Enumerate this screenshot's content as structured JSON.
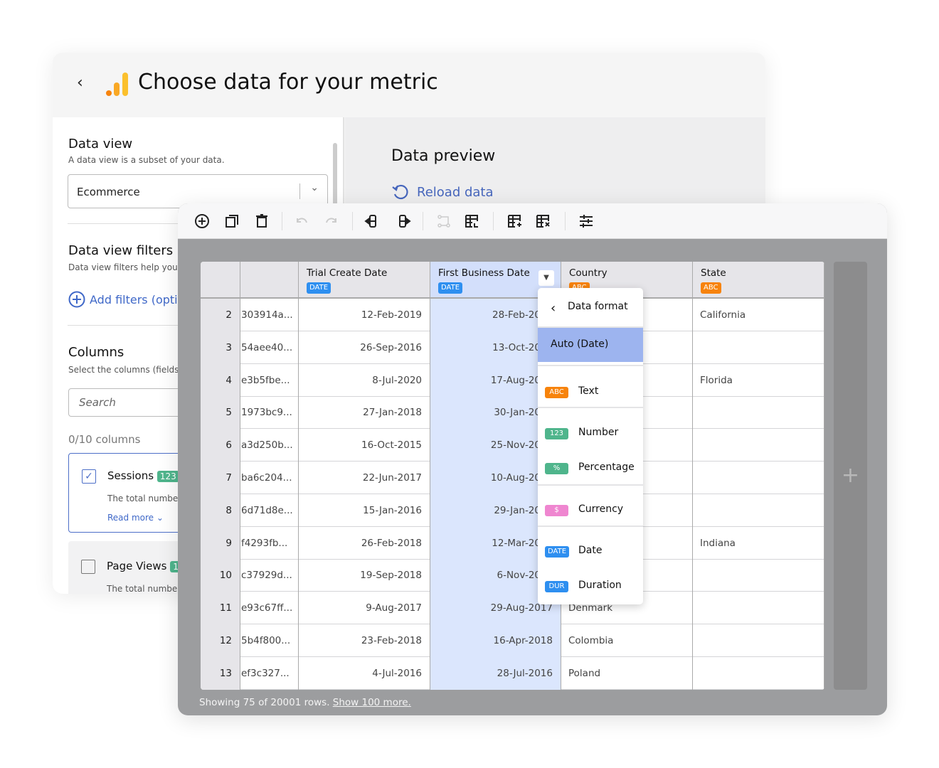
{
  "header": {
    "title": "Choose data for your metric",
    "back_icon": "chevron-left-icon",
    "logo_colors": [
      "#f7830c",
      "#f9a825",
      "#fbc02d"
    ]
  },
  "left": {
    "data_view": {
      "title": "Data view",
      "subtitle": "A data view is a subset of your data.",
      "selected": "Ecommerce"
    },
    "filters": {
      "title": "Data view filters",
      "subtitle": "Data view filters help you r",
      "add_label": "Add filters (optic"
    },
    "columns": {
      "title": "Columns",
      "subtitle": "Select the columns (fields)",
      "search_placeholder": "Search",
      "count": "0/10 columns",
      "items": [
        {
          "name": "Sessions",
          "badge": "123",
          "desc": "The total number",
          "read_more": "Read more",
          "checked": true
        },
        {
          "name": "Page Views",
          "badge": "1",
          "desc": "The total number",
          "checked": false
        }
      ]
    }
  },
  "preview": {
    "title": "Data preview",
    "reload": "Reload data"
  },
  "toolbar": {
    "icons": [
      "add-circle-icon",
      "duplicate-icon",
      "delete-icon",
      "undo-icon",
      "redo-icon",
      "insert-column-left-icon",
      "insert-column-right-icon",
      "link-icon",
      "table-move-icon",
      "table-add-row-icon",
      "table-delete-row-icon",
      "settings-sliders-icon"
    ]
  },
  "table": {
    "columns": [
      {
        "label": ""
      },
      {
        "label": ""
      },
      {
        "label": "Trial Create Date",
        "badge": "DATE"
      },
      {
        "label": "First Business Date",
        "badge": "DATE"
      },
      {
        "label": "Country",
        "badge": "ABC"
      },
      {
        "label": "State",
        "badge": "ABC"
      }
    ],
    "rows": [
      [
        "2",
        "303914a...",
        "12-Feb-2019",
        "28-Feb-20",
        "",
        "California"
      ],
      [
        "3",
        "54aee40...",
        "26-Sep-2016",
        "13-Oct-20",
        "",
        ""
      ],
      [
        "4",
        "e3b5fbe...",
        "8-Jul-2020",
        "17-Aug-20",
        "",
        "Florida"
      ],
      [
        "5",
        "1973bc9...",
        "27-Jan-2018",
        "30-Jan-20",
        "",
        ""
      ],
      [
        "6",
        "a3d250b...",
        "16-Oct-2015",
        "25-Nov-20",
        "",
        ""
      ],
      [
        "7",
        "ba6c204...",
        "22-Jun-2017",
        "10-Aug-20",
        "",
        ""
      ],
      [
        "8",
        "6d71d8e...",
        "15-Jan-2016",
        "29-Jan-20",
        "",
        ""
      ],
      [
        "9",
        "f4293fb...",
        "26-Feb-2018",
        "12-Mar-20",
        "",
        "Indiana"
      ],
      [
        "10",
        "c37929d...",
        "19-Sep-2018",
        "6-Nov-20",
        "",
        ""
      ],
      [
        "11",
        "e93c67ff...",
        "9-Aug-2017",
        "29-Aug-2017",
        "Denmark",
        ""
      ],
      [
        "12",
        "5b4f800...",
        "23-Feb-2018",
        "16-Apr-2018",
        "Colombia",
        ""
      ],
      [
        "13",
        "ef3c327...",
        "4-Jul-2016",
        "28-Jul-2016",
        "Poland",
        ""
      ]
    ],
    "selected_column": "First Business Date",
    "footer": {
      "text": "Showing 75 of 20001 rows.",
      "link": "Show 100 more."
    },
    "add_column": "+"
  },
  "menu": {
    "title": "Data format",
    "selected": "Auto (Date)",
    "items": [
      {
        "badge": "ABC",
        "label": "Text",
        "color": "#f7830c"
      },
      {
        "badge": "123",
        "label": "Number",
        "color": "#4fb58c"
      },
      {
        "badge": "%",
        "label": "Percentage",
        "color": "#4fb58c"
      },
      {
        "badge": "$",
        "label": "Currency",
        "color": "#ef86d0"
      },
      {
        "badge": "DATE",
        "label": "Date",
        "color": "#2e8ff0"
      },
      {
        "badge": "DUR",
        "label": "Duration",
        "color": "#2e8ff0"
      }
    ]
  },
  "colors": {
    "accent": "#3f68c8",
    "selected_column": "#dbe6fd",
    "menu_selected": "#9db4ef"
  }
}
